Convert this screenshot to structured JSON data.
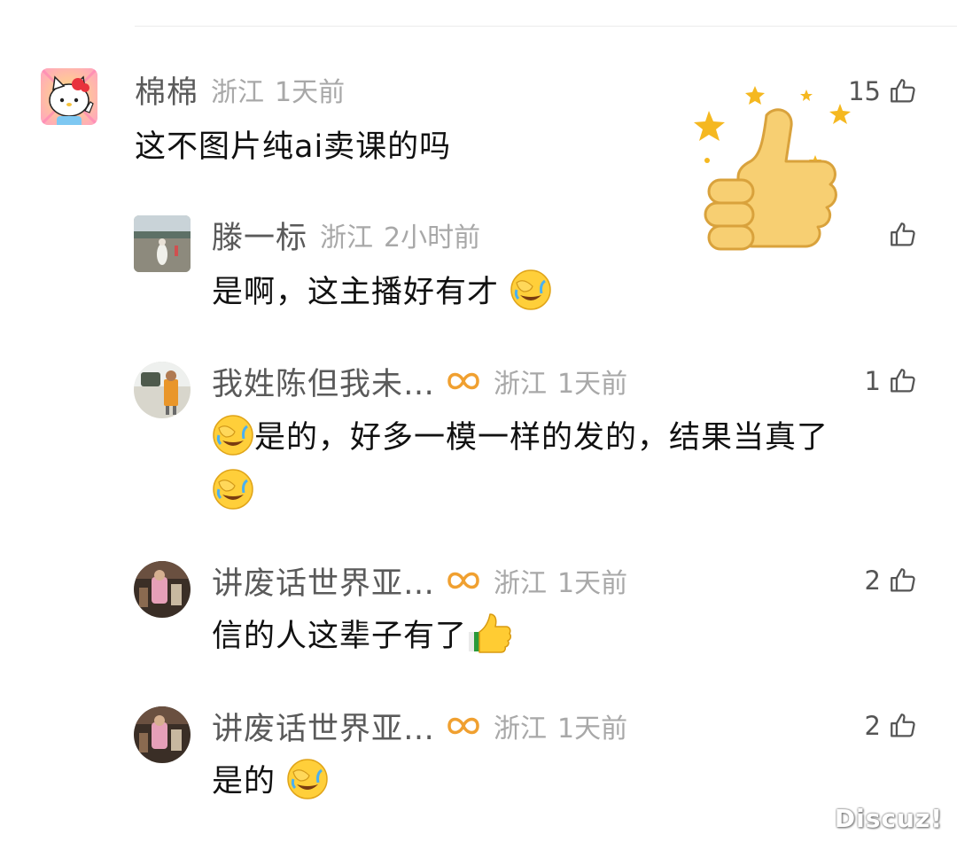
{
  "comments": [
    {
      "username": "棉棉",
      "location": "浙江",
      "time": "1天前",
      "likes": "15",
      "text": "这不图片纯ai卖课的吗"
    },
    {
      "username": "滕一标",
      "location": "浙江",
      "time": "2小时前",
      "likes": "",
      "text": "是啊，这主播好有才"
    },
    {
      "username": "我姓陈但我未…",
      "location": "浙江",
      "time": "1天前",
      "likes": "1",
      "text_line1": "是的，好多一模一样的发的，结果当真了"
    },
    {
      "username": "讲废话世界亚…",
      "location": "浙江",
      "time": "1天前",
      "likes": "2",
      "text": "信的人这辈子有了"
    },
    {
      "username": "讲废话世界亚…",
      "location": "浙江",
      "time": "1天前",
      "likes": "2",
      "text": "是的"
    }
  ],
  "watermark": "Discuz!",
  "icons": {
    "like": "thumbs-up-outline-icon",
    "badge": "infinity-badge-icon",
    "sticker": "big-thumbs-up-sticker",
    "emoji_laugh": "facepalm-laugh-emoji",
    "emoji_thumb": "thumbs-up-emoji"
  },
  "colors": {
    "username": "#5a5a5a",
    "meta": "#a8a8a8",
    "text": "#111111",
    "badge": "#f0a030"
  }
}
